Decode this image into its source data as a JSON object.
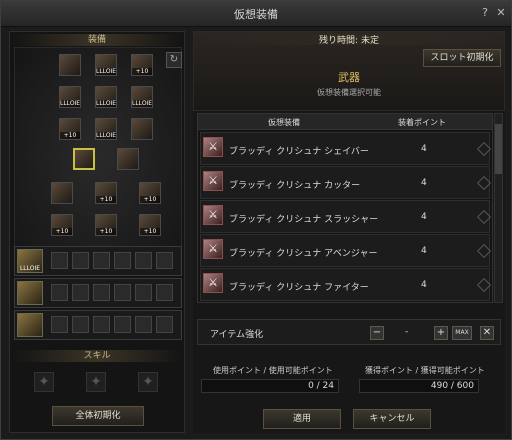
{
  "window": {
    "title": "仮想装備",
    "help": "?",
    "close": "✕"
  },
  "left": {
    "equip_header": "装備",
    "refresh": "↻",
    "skill_header": "スキル",
    "reset_all": "全体初期化",
    "equip_slots": [
      {
        "label": ""
      },
      {
        "label": "LLLOIE"
      },
      {
        "label": "+10"
      },
      {
        "label": "LLLOIE"
      },
      {
        "label": "LLLOIE"
      },
      {
        "label": "LLLOIE"
      },
      {
        "label": "+10"
      },
      {
        "label": "LLLOIE"
      },
      {
        "label": ""
      },
      {
        "label": ""
      },
      {
        "label": ""
      },
      {
        "label": ""
      },
      {
        "label": "+10"
      },
      {
        "label": "+10"
      },
      {
        "label": "+10"
      },
      {
        "label": "+10"
      },
      {
        "label": "+10"
      }
    ],
    "gem_rows": [
      {
        "label": "LLLOIE"
      },
      {
        "label": ""
      },
      {
        "label": ""
      }
    ]
  },
  "right": {
    "remaining_time": "残り時間: 未定",
    "slot_reset": "スロット初期化",
    "weapon_title": "武器",
    "weapon_sub": "仮想装備選択可能",
    "list_header": {
      "name": "仮想装備",
      "points": "装着ポイント"
    },
    "items": [
      {
        "name": "ブラッディ クリシュナ シェイバー",
        "points": "4"
      },
      {
        "name": "ブラッディ クリシュナ カッター",
        "points": "4"
      },
      {
        "name": "ブラッディ クリシュナ スラッシャー",
        "points": "4"
      },
      {
        "name": "ブラッディ クリシュナ アベンジャー",
        "points": "4"
      },
      {
        "name": "ブラッディ クリシュナ ファイター",
        "points": "4"
      }
    ],
    "enhance": {
      "label": "アイテム強化",
      "minus": "−",
      "value": "-",
      "plus": "+",
      "max": "MAX",
      "cancel": "✕"
    },
    "use_points": {
      "label": "使用ポイント / 使用可能ポイント",
      "value": "0 / 24"
    },
    "get_points": {
      "label": "獲得ポイント / 獲得可能ポイント",
      "value": "490 / 600"
    },
    "apply": "適用",
    "cancel": "キャンセル"
  }
}
